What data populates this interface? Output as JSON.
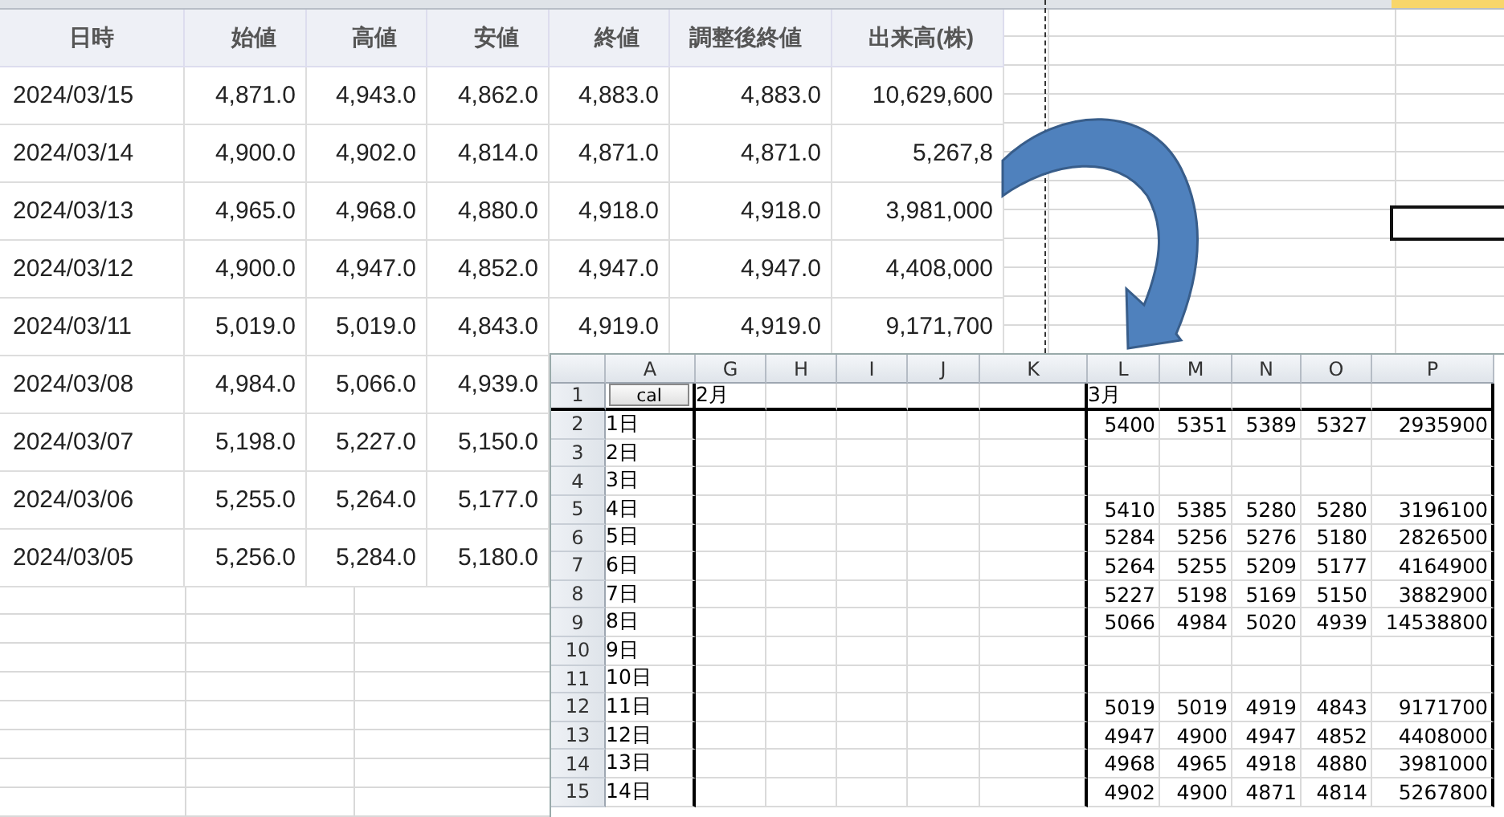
{
  "stock_table": {
    "columns": [
      "日時",
      "始値",
      "高値",
      "安値",
      "終値",
      "調整後終値",
      "出来高(株)"
    ],
    "rows": [
      {
        "cells": [
          "2024/03/15",
          "4,871.0",
          "4,943.0",
          "4,862.0",
          "4,883.0",
          "4,883.0",
          "10,629,600"
        ]
      },
      {
        "cells": [
          "2024/03/14",
          "4,900.0",
          "4,902.0",
          "4,814.0",
          "4,871.0",
          "4,871.0",
          "5,267,8"
        ]
      },
      {
        "cells": [
          "2024/03/13",
          "4,965.0",
          "4,968.0",
          "4,880.0",
          "4,918.0",
          "4,918.0",
          "3,981,000"
        ]
      },
      {
        "cells": [
          "2024/03/12",
          "4,900.0",
          "4,947.0",
          "4,852.0",
          "4,947.0",
          "4,947.0",
          "4,408,000"
        ]
      },
      {
        "cells": [
          "2024/03/11",
          "5,019.0",
          "5,019.0",
          "4,843.0",
          "4,919.0",
          "4,919.0",
          "9,171,700"
        ]
      },
      {
        "cells": [
          "2024/03/08",
          "4,984.0",
          "5,066.0",
          "4,939.0"
        ]
      },
      {
        "cells": [
          "2024/03/07",
          "5,198.0",
          "5,227.0",
          "5,150.0"
        ]
      },
      {
        "cells": [
          "2024/03/06",
          "5,255.0",
          "5,264.0",
          "5,177.0"
        ]
      },
      {
        "cells": [
          "2024/03/05",
          "5,256.0",
          "5,284.0",
          "5,180.0"
        ]
      }
    ]
  },
  "inset_sheet": {
    "columns": [
      "A",
      "G",
      "H",
      "I",
      "J",
      "K",
      "L",
      "M",
      "N",
      "O",
      "P"
    ],
    "title_row": {
      "number": "1",
      "button": "cal",
      "february_label": "2月",
      "march_label": "3月"
    },
    "rows": [
      {
        "number": "2",
        "day": "1日",
        "values": [
          "5400",
          "5351",
          "5389",
          "5327",
          "2935900"
        ]
      },
      {
        "number": "3",
        "day": "2日"
      },
      {
        "number": "4",
        "day": "3日"
      },
      {
        "number": "5",
        "day": "4日",
        "values": [
          "5410",
          "5385",
          "5280",
          "5280",
          "3196100"
        ]
      },
      {
        "number": "6",
        "day": "5日",
        "values": [
          "5284",
          "5256",
          "5276",
          "5180",
          "2826500"
        ]
      },
      {
        "number": "7",
        "day": "6日",
        "values": [
          "5264",
          "5255",
          "5209",
          "5177",
          "4164900"
        ]
      },
      {
        "number": "8",
        "day": "7日",
        "values": [
          "5227",
          "5198",
          "5169",
          "5150",
          "3882900"
        ]
      },
      {
        "number": "9",
        "day": "8日",
        "values": [
          "5066",
          "4984",
          "5020",
          "4939",
          "14538800"
        ]
      },
      {
        "number": "10",
        "day": "9日"
      },
      {
        "number": "11",
        "day": "10日"
      },
      {
        "number": "12",
        "day": "11日",
        "values": [
          "5019",
          "5019",
          "4919",
          "4843",
          "9171700"
        ]
      },
      {
        "number": "13",
        "day": "12日",
        "values": [
          "4947",
          "4900",
          "4947",
          "4852",
          "4408000"
        ]
      },
      {
        "number": "14",
        "day": "13日",
        "values": [
          "4968",
          "4965",
          "4918",
          "4880",
          "3981000"
        ]
      },
      {
        "number": "15",
        "day": "14日",
        "values": [
          "4902",
          "4900",
          "4871",
          "4814",
          "5267800"
        ]
      }
    ]
  }
}
